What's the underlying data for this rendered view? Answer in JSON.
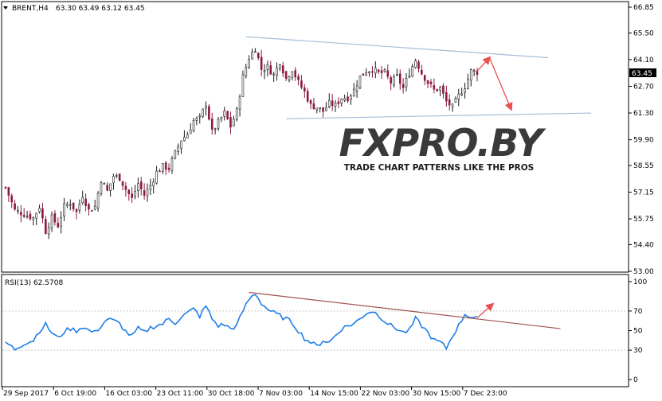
{
  "header": {
    "menu_icon": "triangle-down-icon",
    "symbol": "BRENT,H4",
    "ohlc": "63.30 63.49 63.12 63.45"
  },
  "rsi_header": "RSI(13) 62.5708",
  "watermark": {
    "brand": "FXPRO.BY",
    "tagline": "TRADE CHART PATTERNS LIKE THE PROS"
  },
  "colors": {
    "bull_candle": "#1a1a1a",
    "bear_candle": "#8b1a3a",
    "rsi_line": "#1e7ee8",
    "channel_line": "#a6bdd8",
    "rsi_trendline": "#a0524d",
    "arrow": "#e85050",
    "price_tag_bg": "#000000"
  },
  "chart_data": [
    {
      "type": "candlestick",
      "symbol": "BRENT",
      "timeframe": "H4",
      "last_price": "63.45",
      "y_ticks": [
        "66.85",
        "65.50",
        "64.10",
        "62.70",
        "61.30",
        "59.90",
        "58.55",
        "57.15",
        "55.75",
        "54.40",
        "53.00"
      ],
      "ylim": [
        53.0,
        66.85
      ],
      "x_ticks": [
        "29 Sep 2017",
        "6 Oct 19:00",
        "16 Oct 03:00",
        "23 Oct 11:00",
        "30 Oct 18:00",
        "7 Nov 03:00",
        "14 Nov 15:00",
        "22 Nov 03:00",
        "30 Nov 15:00",
        "7 Dec 23:00"
      ],
      "close_path": [
        [
          0,
          57.4
        ],
        [
          3,
          56.2
        ],
        [
          6,
          56.0
        ],
        [
          9,
          55.8
        ],
        [
          11,
          56.4
        ],
        [
          13,
          55.1
        ],
        [
          15,
          55.8
        ],
        [
          17,
          55.4
        ],
        [
          19,
          56.4
        ],
        [
          21,
          56.6
        ],
        [
          23,
          56.1
        ],
        [
          25,
          57.0
        ],
        [
          27,
          56.2
        ],
        [
          29,
          56.4
        ],
        [
          31,
          57.8
        ],
        [
          33,
          57.2
        ],
        [
          35,
          58.0
        ],
        [
          37,
          57.9
        ],
        [
          39,
          57.3
        ],
        [
          41,
          56.8
        ],
        [
          43,
          57.6
        ],
        [
          45,
          57.0
        ],
        [
          47,
          57.5
        ],
        [
          49,
          58.2
        ],
        [
          51,
          58.5
        ],
        [
          53,
          58.4
        ],
        [
          55,
          59.2
        ],
        [
          57,
          59.9
        ],
        [
          59,
          60.2
        ],
        [
          61,
          60.9
        ],
        [
          63,
          61.0
        ],
        [
          65,
          61.8
        ],
        [
          67,
          60.3
        ],
        [
          69,
          60.8
        ],
        [
          71,
          61.3
        ],
        [
          73,
          60.6
        ],
        [
          75,
          61.4
        ],
        [
          77,
          63.2
        ],
        [
          79,
          64.2
        ],
        [
          81,
          64.7
        ],
        [
          83,
          63.6
        ],
        [
          85,
          63.7
        ],
        [
          87,
          63.3
        ],
        [
          89,
          64.0
        ],
        [
          91,
          63.1
        ],
        [
          93,
          63.6
        ],
        [
          95,
          62.9
        ],
        [
          97,
          62.4
        ],
        [
          99,
          61.7
        ],
        [
          101,
          61.6
        ],
        [
          103,
          61.4
        ],
        [
          105,
          61.8
        ],
        [
          107,
          61.7
        ],
        [
          109,
          62.1
        ],
        [
          111,
          62.1
        ],
        [
          113,
          62.5
        ],
        [
          115,
          63.2
        ],
        [
          117,
          63.5
        ],
        [
          119,
          63.6
        ],
        [
          121,
          63.4
        ],
        [
          123,
          63.4
        ],
        [
          125,
          62.9
        ],
        [
          127,
          63.2
        ],
        [
          129,
          62.6
        ],
        [
          131,
          63.4
        ],
        [
          133,
          64.1
        ],
        [
          135,
          63.4
        ],
        [
          137,
          62.9
        ],
        [
          139,
          62.5
        ],
        [
          141,
          62.6
        ],
        [
          143,
          61.9
        ],
        [
          145,
          61.6
        ],
        [
          147,
          62.2
        ],
        [
          149,
          62.7
        ],
        [
          151,
          63.5
        ],
        [
          153,
          63.45
        ]
      ],
      "annotations": [
        {
          "type": "channel-upper",
          "points": [
            [
              78,
              65.3
            ],
            [
              176,
              64.2
            ]
          ]
        },
        {
          "type": "channel-lower",
          "points": [
            [
              91,
              61.0
            ],
            [
              190,
              61.3
            ]
          ]
        },
        {
          "type": "arrow-up",
          "from": [
            153,
            63.5
          ],
          "to": [
            157,
            64.2
          ]
        },
        {
          "type": "arrow-down",
          "from": [
            157,
            64.2
          ],
          "to": [
            164,
            61.5
          ]
        }
      ]
    },
    {
      "type": "line",
      "name": "RSI(13)",
      "last_value": "62.5708",
      "y_ticks": [
        "100",
        "70",
        "50",
        "30",
        "0"
      ],
      "ylim": [
        0,
        100
      ],
      "values_path": [
        [
          0,
          38
        ],
        [
          3,
          31
        ],
        [
          6,
          37
        ],
        [
          9,
          40
        ],
        [
          11,
          50
        ],
        [
          13,
          56
        ],
        [
          15,
          48
        ],
        [
          17,
          42
        ],
        [
          19,
          49
        ],
        [
          21,
          52
        ],
        [
          23,
          50
        ],
        [
          25,
          54
        ],
        [
          27,
          50
        ],
        [
          29,
          48
        ],
        [
          31,
          55
        ],
        [
          33,
          62
        ],
        [
          35,
          60
        ],
        [
          37,
          57
        ],
        [
          39,
          49
        ],
        [
          41,
          44
        ],
        [
          43,
          52
        ],
        [
          45,
          48
        ],
        [
          47,
          53
        ],
        [
          49,
          55
        ],
        [
          51,
          57
        ],
        [
          53,
          62
        ],
        [
          55,
          58
        ],
        [
          57,
          64
        ],
        [
          59,
          68
        ],
        [
          61,
          72
        ],
        [
          63,
          65
        ],
        [
          65,
          75
        ],
        [
          67,
          62
        ],
        [
          69,
          55
        ],
        [
          71,
          56
        ],
        [
          73,
          52
        ],
        [
          75,
          55
        ],
        [
          77,
          70
        ],
        [
          79,
          82
        ],
        [
          81,
          88
        ],
        [
          83,
          78
        ],
        [
          85,
          72
        ],
        [
          87,
          68
        ],
        [
          89,
          65
        ],
        [
          91,
          62
        ],
        [
          93,
          58
        ],
        [
          95,
          50
        ],
        [
          97,
          42
        ],
        [
          99,
          38
        ],
        [
          101,
          34
        ],
        [
          103,
          40
        ],
        [
          105,
          38
        ],
        [
          107,
          45
        ],
        [
          109,
          52
        ],
        [
          111,
          55
        ],
        [
          113,
          57
        ],
        [
          115,
          62
        ],
        [
          117,
          68
        ],
        [
          119,
          70
        ],
        [
          121,
          66
        ],
        [
          123,
          60
        ],
        [
          125,
          55
        ],
        [
          127,
          52
        ],
        [
          129,
          48
        ],
        [
          131,
          50
        ],
        [
          133,
          62
        ],
        [
          135,
          55
        ],
        [
          137,
          48
        ],
        [
          139,
          40
        ],
        [
          141,
          38
        ],
        [
          143,
          32
        ],
        [
          145,
          45
        ],
        [
          147,
          55
        ],
        [
          149,
          67
        ],
        [
          151,
          64
        ],
        [
          153,
          62.57
        ]
      ],
      "annotations": [
        {
          "type": "trendline",
          "points": [
            [
              79,
              89
            ],
            [
              180,
              52
            ]
          ]
        },
        {
          "type": "arrow-up",
          "from": [
            153,
            63
          ],
          "to": [
            158,
            77
          ]
        }
      ]
    }
  ]
}
